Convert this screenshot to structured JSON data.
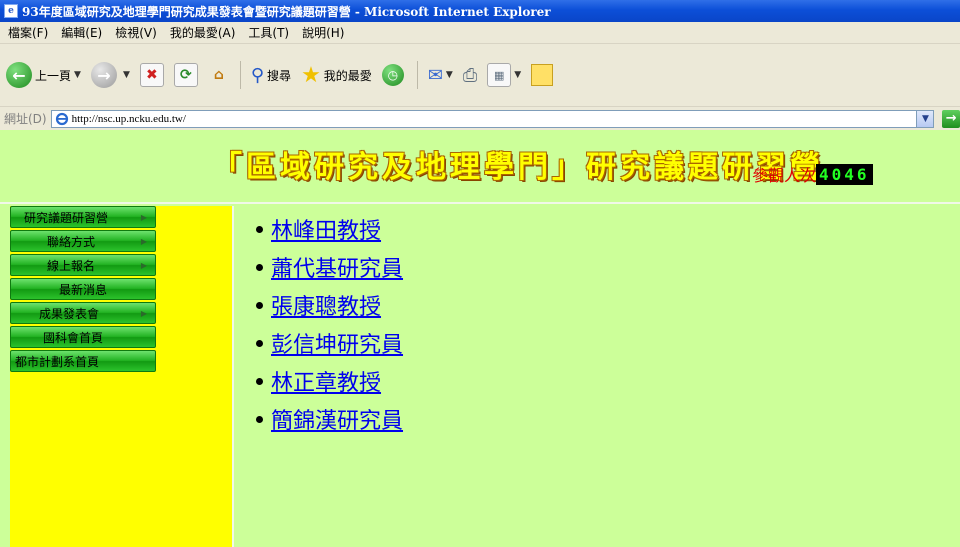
{
  "window": {
    "title": "93年度區域研究及地理學門研究成果發表會暨研究議題研習營 - Microsoft Internet Explorer"
  },
  "menu": [
    "檔案(F)",
    "編輯(E)",
    "檢視(V)",
    "我的最愛(A)",
    "工具(T)",
    "說明(H)"
  ],
  "toolbar": {
    "back_label": "上一頁",
    "search_label": "搜尋",
    "favorites_label": "我的最愛"
  },
  "address": {
    "label": "網址(D)",
    "url": "http://nsc.up.ncku.edu.tw/"
  },
  "banner": {
    "title": "「區域研究及地理學門」研究議題研習營",
    "visitor_label": "參觀人次",
    "visitor_count": "4046"
  },
  "sidebar": {
    "items": [
      {
        "label": "研究議題研習營",
        "has_arrow": true
      },
      {
        "label": "聯絡方式",
        "has_arrow": true
      },
      {
        "label": "線上報名",
        "has_arrow": true
      },
      {
        "label": "最新消息",
        "has_arrow": false
      },
      {
        "label": "成果發表會",
        "has_arrow": true
      },
      {
        "label": "國科會首頁",
        "has_arrow": false
      },
      {
        "label": "都市計劃系首頁",
        "has_arrow": false
      }
    ]
  },
  "content": {
    "people": [
      "林峰田教授",
      "蕭代基研究員",
      "張康聰教授",
      "彭信坤研究員",
      "林正章教授",
      "簡錦漢研究員"
    ]
  },
  "colors": {
    "page_bg": "#ccff99",
    "sidebar_bg": "#ffff00",
    "nav_green": "#22b322",
    "link": "#0000ee",
    "visitor_label": "#e00000"
  }
}
